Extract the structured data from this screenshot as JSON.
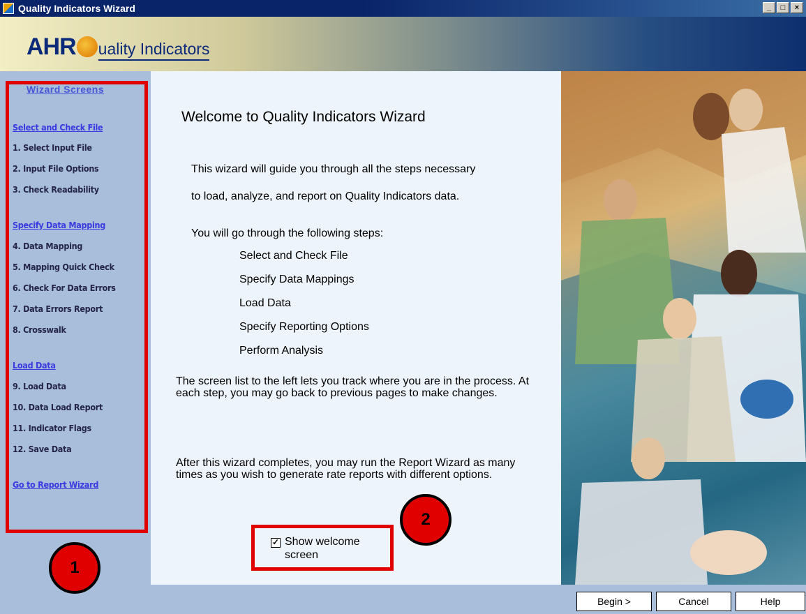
{
  "window": {
    "title": "Quality Indicators Wizard",
    "controls": [
      "_",
      "□",
      "×"
    ]
  },
  "banner": {
    "logo_prefix": "AHR",
    "logo_rest": "uality Indicators"
  },
  "sidebar": {
    "heading": "Wizard Screens",
    "items": [
      {
        "label": "Select and Check File",
        "kind": "section"
      },
      {
        "label": "1. Select Input File",
        "kind": "step"
      },
      {
        "label": "2. Input File Options",
        "kind": "step"
      },
      {
        "label": "3. Check Readability",
        "kind": "step"
      },
      {
        "label": "Specify Data Mapping",
        "kind": "section"
      },
      {
        "label": "4. Data Mapping",
        "kind": "step"
      },
      {
        "label": "5. Mapping Quick Check",
        "kind": "step"
      },
      {
        "label": "6. Check For Data Errors",
        "kind": "step"
      },
      {
        "label": "7. Data Errors Report",
        "kind": "step"
      },
      {
        "label": "8. Crosswalk",
        "kind": "step"
      },
      {
        "label": "Load Data",
        "kind": "section"
      },
      {
        "label": "9. Load Data",
        "kind": "step"
      },
      {
        "label": "10. Data Load Report",
        "kind": "step"
      },
      {
        "label": "11. Indicator Flags",
        "kind": "step"
      },
      {
        "label": "12. Save Data",
        "kind": "step"
      },
      {
        "label": "Go to Report Wizard",
        "kind": "section"
      }
    ]
  },
  "main": {
    "title": "Welcome to Quality Indicators Wizard",
    "intro_line1": "This wizard will guide you through all the steps necessary",
    "intro_line2": "to load, analyze, and report on Quality Indicators data.",
    "steps_heading": "You will go through the following steps:",
    "steps": [
      "Select and Check File",
      "Specify Data Mappings",
      "Load Data",
      "Specify Reporting Options",
      "Perform Analysis"
    ],
    "track_text": "The screen list to the left lets you track where you are in the process.  At each step, you may go back to previous pages to make changes.",
    "after_text": "After this wizard completes, you may run the Report Wizard as many times as you wish to generate rate reports with different options.",
    "show_welcome_label": "Show welcome screen",
    "show_welcome_checked": true
  },
  "buttons": {
    "begin": "Begin >",
    "cancel": "Cancel",
    "help": "Help"
  },
  "callouts": [
    "1",
    "2"
  ]
}
